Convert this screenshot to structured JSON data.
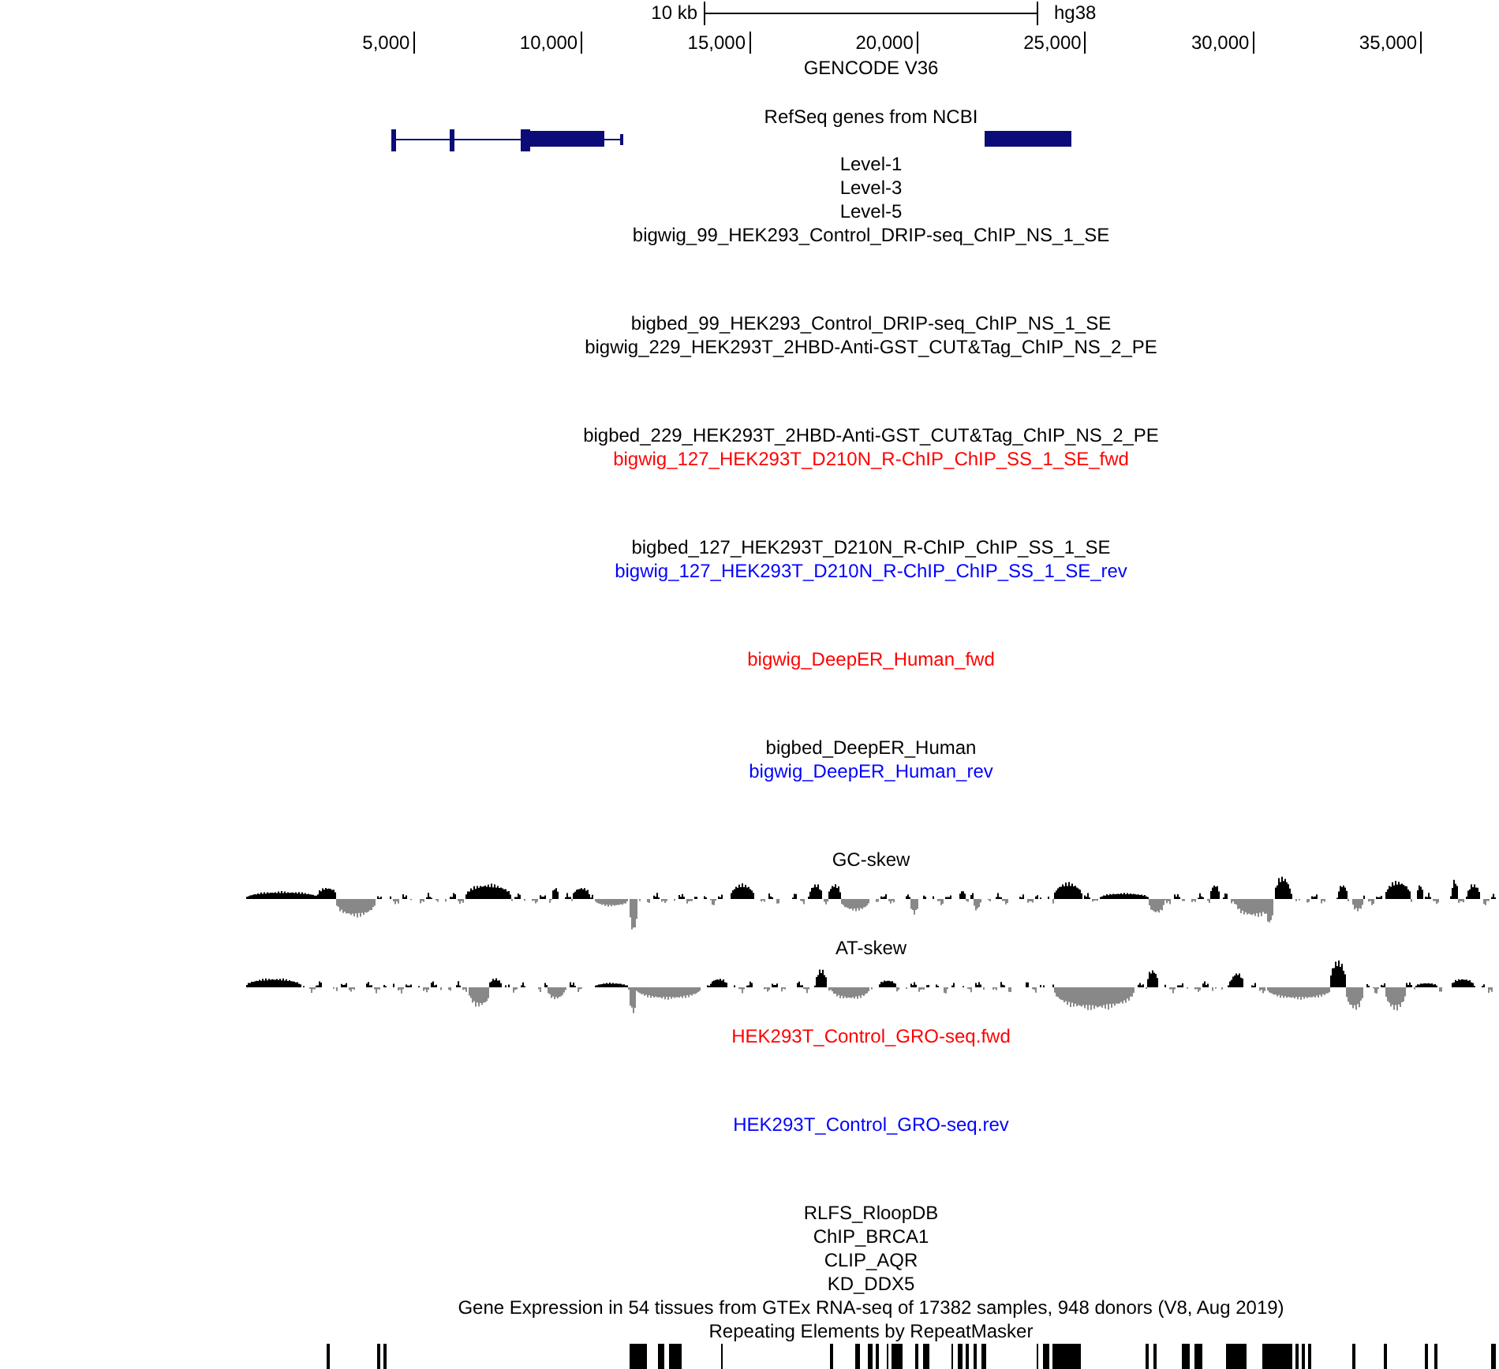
{
  "scale_bar": {
    "span_label": "10 kb",
    "assembly": "hg38"
  },
  "ruler": {
    "ticks": [
      "5,000",
      "10,000",
      "15,000",
      "20,000",
      "25,000",
      "30,000",
      "35,000"
    ]
  },
  "tracks": [
    {
      "kind": "annotation",
      "title": "GENCODE V36",
      "color": "#000000"
    },
    {
      "kind": "genes",
      "title": "RefSeq genes from NCBI",
      "color": "#000000"
    },
    {
      "kind": "label",
      "title": "Level-1",
      "color": "#000000"
    },
    {
      "kind": "label",
      "title": "Level-3",
      "color": "#000000"
    },
    {
      "kind": "label",
      "title": "Level-5",
      "color": "#000000"
    },
    {
      "kind": "signal",
      "title": "bigwig_99_HEK293_Control_DRIP-seq_ChIP_NS_1_SE",
      "color": "#000000"
    },
    {
      "kind": "label",
      "title": "bigbed_99_HEK293_Control_DRIP-seq_ChIP_NS_1_SE",
      "color": "#000000"
    },
    {
      "kind": "signal",
      "title": "bigwig_229_HEK293T_2HBD-Anti-GST_CUT&Tag_ChIP_NS_2_PE",
      "color": "#000000"
    },
    {
      "kind": "label",
      "title": "bigbed_229_HEK293T_2HBD-Anti-GST_CUT&Tag_ChIP_NS_2_PE",
      "color": "#000000"
    },
    {
      "kind": "signal",
      "title": "bigwig_127_HEK293T_D210N_R-ChIP_ChIP_SS_1_SE_fwd",
      "color": "#ff0000"
    },
    {
      "kind": "label",
      "title": "bigbed_127_HEK293T_D210N_R-ChIP_ChIP_SS_1_SE",
      "color": "#000000"
    },
    {
      "kind": "signal",
      "title": "bigwig_127_HEK293T_D210N_R-ChIP_ChIP_SS_1_SE_rev",
      "color": "#0000ff"
    },
    {
      "kind": "signal",
      "title": "bigwig_DeepER_Human_fwd",
      "color": "#ff0000"
    },
    {
      "kind": "label",
      "title": "bigbed_DeepER_Human",
      "color": "#000000"
    },
    {
      "kind": "signal",
      "title": "bigwig_DeepER_Human_rev",
      "color": "#0000ff"
    },
    {
      "kind": "skew",
      "title": "GC-skew",
      "color": "#000000"
    },
    {
      "kind": "skew",
      "title": "AT-skew",
      "color": "#000000"
    },
    {
      "kind": "signal",
      "title": "HEK293T_Control_GRO-seq.fwd",
      "color": "#ff0000"
    },
    {
      "kind": "signal",
      "title": "HEK293T_Control_GRO-seq.rev",
      "color": "#0000ff"
    },
    {
      "kind": "label",
      "title": "RLFS_RloopDB",
      "color": "#000000"
    },
    {
      "kind": "label",
      "title": "ChIP_BRCA1",
      "color": "#000000"
    },
    {
      "kind": "label",
      "title": "CLIP_AQR",
      "color": "#000000"
    },
    {
      "kind": "label",
      "title": "KD_DDX5",
      "color": "#000000"
    },
    {
      "kind": "label",
      "title": "Gene Expression in 54 tissues from GTEx RNA-seq of 17382 samples, 948 donors (V8, Aug 2019)",
      "color": "#000000"
    },
    {
      "kind": "repeats",
      "title": "Repeating Elements by RepeatMasker",
      "color": "#000000"
    }
  ]
}
